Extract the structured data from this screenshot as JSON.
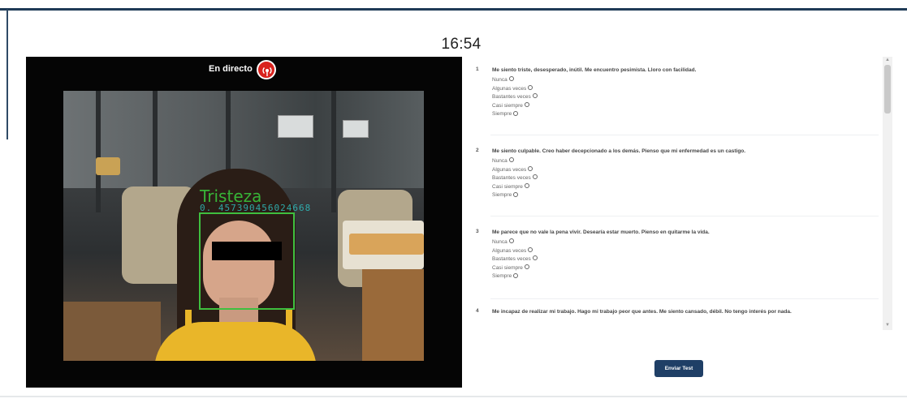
{
  "timer": "16:54",
  "video": {
    "live_label": "En directo",
    "live_icon": "broadcast-icon",
    "emotion_label": "Tristeza",
    "probability_label": "0. 457390456024668"
  },
  "questionnaire": {
    "options": [
      "Nunca",
      "Algunas veces",
      "Bastantes veces",
      "Casi siempre",
      "Siempre"
    ],
    "questions": [
      {
        "number": "1",
        "text": "Me siento triste, desesperado, inútil. Me encuentro pesimista. Lloro con facilidad."
      },
      {
        "number": "2",
        "text": "Me siento culpable. Creo haber decepcionado a los demás. Pienso que mi enfermedad es un castigo."
      },
      {
        "number": "3",
        "text": "Me parece que no vale la pena vivir. Desearía estar muerto. Pienso en quitarme la vida."
      },
      {
        "number": "4",
        "text": "Me incapaz de realizar mi trabajo. Hago mi trabajo peor que antes. Me siento cansado, débil. No tengo interés por nada."
      }
    ]
  },
  "submit_label": "Enviar Test",
  "colors": {
    "frame": "#1f3b57",
    "button": "#1f3f66",
    "live_red": "#d9221d",
    "face_box": "#3fbf3f"
  }
}
